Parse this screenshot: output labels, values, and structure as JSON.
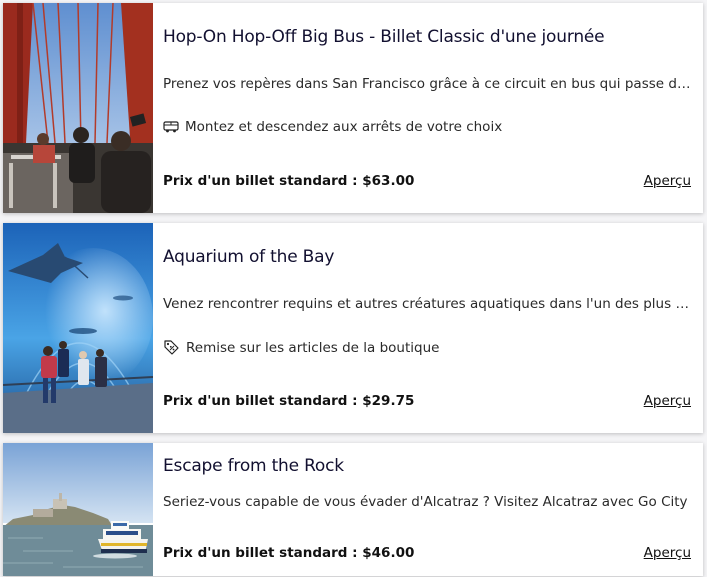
{
  "cards": [
    {
      "title": "Hop-On Hop-Off Big Bus - Billet Classic d'une journée",
      "description": "Prenez vos repères dans San Francisco grâce à ce circuit en bus qui passe devant les sites les plus emblématiques de la ville",
      "feature": "Montez et descendez aux arrêts de votre choix",
      "feature_icon": "bus-icon",
      "price": "Prix d'un billet standard : $63.00",
      "link": "Aperçu",
      "image": "golden-gate-bus-photo"
    },
    {
      "title": "Aquarium of the Bay",
      "description": "Venez rencontrer requins et autres créatures aquatiques dans l'un des plus beaux aquariums de la baie",
      "feature": "Remise sur les articles de la boutique",
      "feature_icon": "tag-percent-icon",
      "price": "Prix d'un billet standard : $29.75",
      "link": "Aperçu",
      "image": "aquarium-tunnel-photo"
    },
    {
      "title": "Escape from the Rock",
      "description": "Seriez-vous capable de vous évader d'Alcatraz ? Visitez Alcatraz avec Go City",
      "price": "Prix d'un billet standard : $46.00",
      "link": "Aperçu",
      "image": "alcatraz-ferry-photo"
    }
  ]
}
